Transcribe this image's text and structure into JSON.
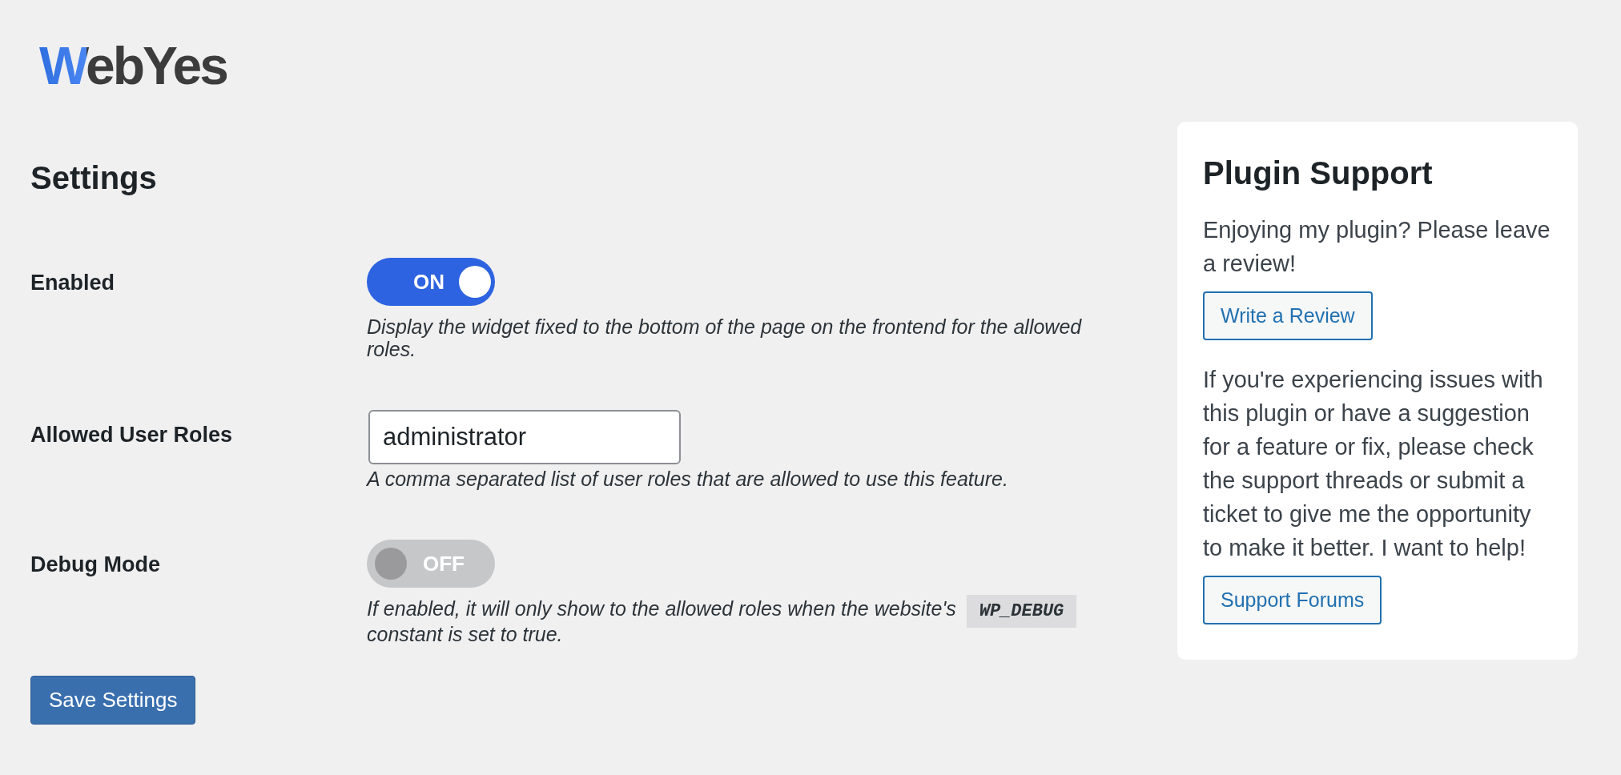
{
  "logo": {
    "text": "WebYes"
  },
  "page_title": "Settings",
  "fields": [
    {
      "kind": "toggle",
      "label": "Enabled",
      "on": true,
      "toggle_text": "ON",
      "description": [
        {
          "kind": "text",
          "text": "Display the widget fixed to the bottom of the page on the frontend for the allowed roles."
        }
      ]
    },
    {
      "kind": "text",
      "label": "Allowed User Roles",
      "value": "administrator",
      "description": [
        {
          "kind": "text",
          "text": "A comma separated list of user roles that are allowed to use this feature."
        }
      ]
    },
    {
      "kind": "toggle",
      "label": "Debug Mode",
      "on": false,
      "toggle_text": "OFF",
      "description": [
        {
          "kind": "text",
          "text": "If enabled, it will only show to the allowed roles when the website's"
        },
        {
          "kind": "code",
          "text": "WP_DEBUG"
        },
        {
          "kind": "text",
          "text": "constant is set to true."
        }
      ]
    }
  ],
  "save_button": "Save Settings",
  "sidebar": {
    "title": "Plugin Support",
    "items": [
      {
        "kind": "paragraph",
        "text": "Enjoying my plugin? Please leave a review!"
      },
      {
        "kind": "button",
        "text": "Write a Review"
      },
      {
        "kind": "paragraph",
        "text": "If you're experiencing issues with this plugin or have a suggestion for a feature or fix, please check the support threads or submit a ticket to give me the opportunity to make it better. I want to help!"
      },
      {
        "kind": "button",
        "text": "Support Forums"
      }
    ]
  }
}
